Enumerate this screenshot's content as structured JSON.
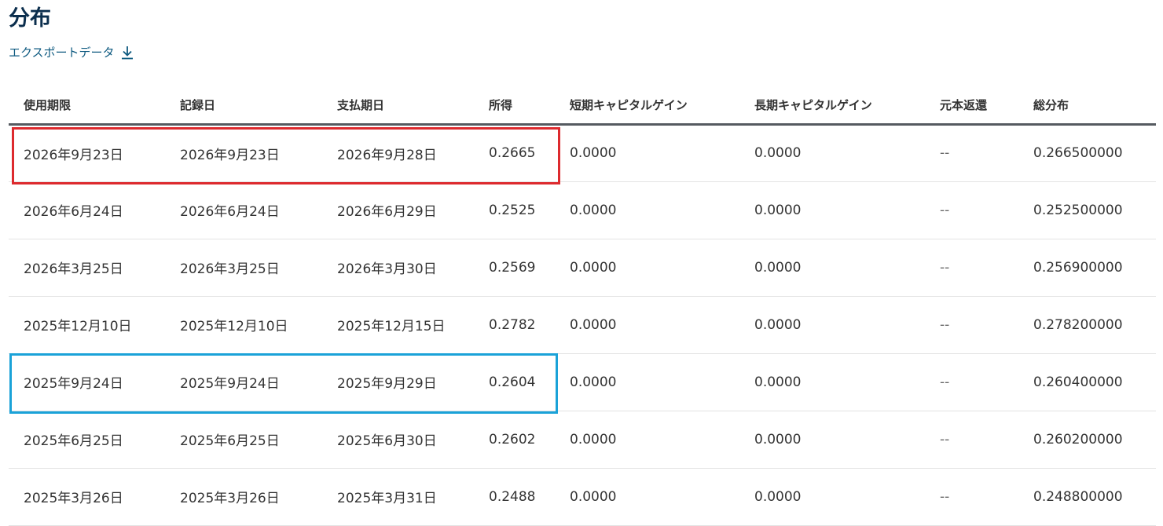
{
  "page": {
    "title": "分布",
    "export_label": "エクスポートデータ",
    "export_icon": "download-icon"
  },
  "table": {
    "headers": [
      "使用期限",
      "記録日",
      "支払期日",
      "所得",
      "短期キャピタルゲイン",
      "長期キャピタルゲイン",
      "元本返還",
      "総分布"
    ],
    "rows": [
      [
        "2026年9月23日",
        "2026年9月23日",
        "2026年9月28日",
        "0.2665",
        "0.0000",
        "0.0000",
        "--",
        "0.266500000"
      ],
      [
        "2026年6月24日",
        "2026年6月24日",
        "2026年6月29日",
        "0.2525",
        "0.0000",
        "0.0000",
        "--",
        "0.252500000"
      ],
      [
        "2026年3月25日",
        "2026年3月25日",
        "2026年3月30日",
        "0.2569",
        "0.0000",
        "0.0000",
        "--",
        "0.256900000"
      ],
      [
        "2025年12月10日",
        "2025年12月10日",
        "2025年12月15日",
        "0.2782",
        "0.0000",
        "0.0000",
        "--",
        "0.278200000"
      ],
      [
        "2025年9月24日",
        "2025年9月24日",
        "2025年9月29日",
        "0.2604",
        "0.0000",
        "0.0000",
        "--",
        "0.260400000"
      ],
      [
        "2025年6月25日",
        "2025年6月25日",
        "2025年6月30日",
        "0.2602",
        "0.0000",
        "0.0000",
        "--",
        "0.260200000"
      ],
      [
        "2025年3月26日",
        "2025年3月26日",
        "2025年3月31日",
        "0.2488",
        "0.0000",
        "0.0000",
        "--",
        "0.248800000"
      ]
    ]
  },
  "highlights": {
    "first_row_color": "#dd2a2e",
    "fifth_row_color": "#1aa2d8"
  },
  "colors": {
    "title": "#0c2f4e",
    "link": "#0e5a80",
    "header_rule": "#555a60"
  }
}
